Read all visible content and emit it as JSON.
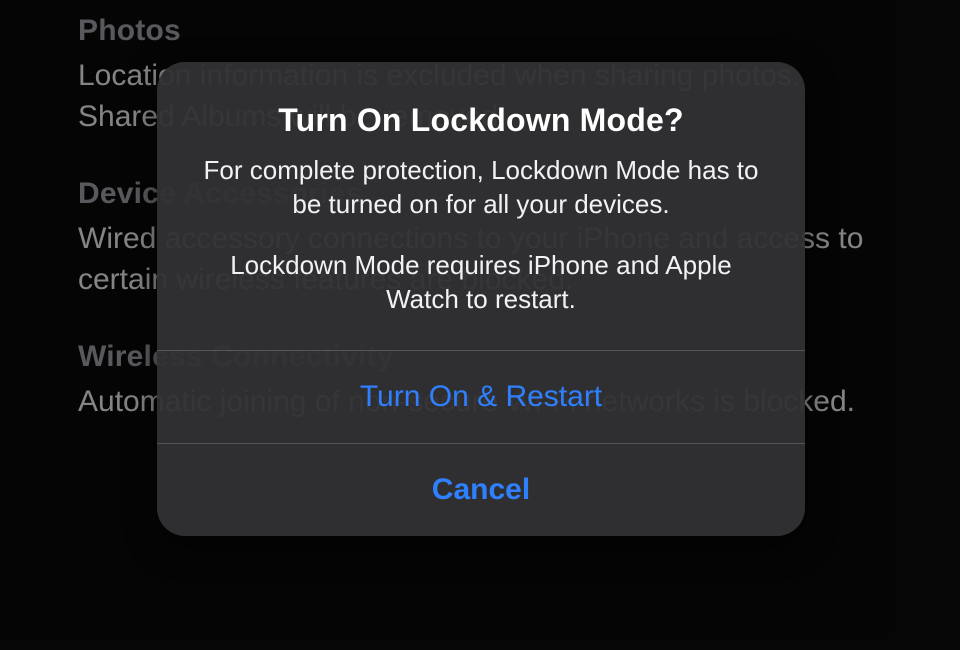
{
  "background": {
    "sections": [
      {
        "heading": "Photos",
        "body": "Location information is excluded when sharing photos. Shared Albums will be removed."
      },
      {
        "heading": "Device Accessories",
        "body": "Wired accessory connections to your iPhone and access to certain wireless features are blocked."
      },
      {
        "heading": "Wireless Connectivity",
        "body": "Automatic joining of non-secure Wi-Fi networks is blocked."
      }
    ]
  },
  "alert": {
    "title": "Turn On Lockdown Mode?",
    "message1": "For complete protection, Lockdown Mode has to be turned on for all your devices.",
    "message2": "Lockdown Mode requires iPhone and Apple Watch to restart.",
    "primary_label": "Turn On & Restart",
    "cancel_label": "Cancel"
  },
  "colors": {
    "accent": "#2f80ff",
    "modal_bg": "#323234",
    "page_bg": "#0a0a0c"
  }
}
